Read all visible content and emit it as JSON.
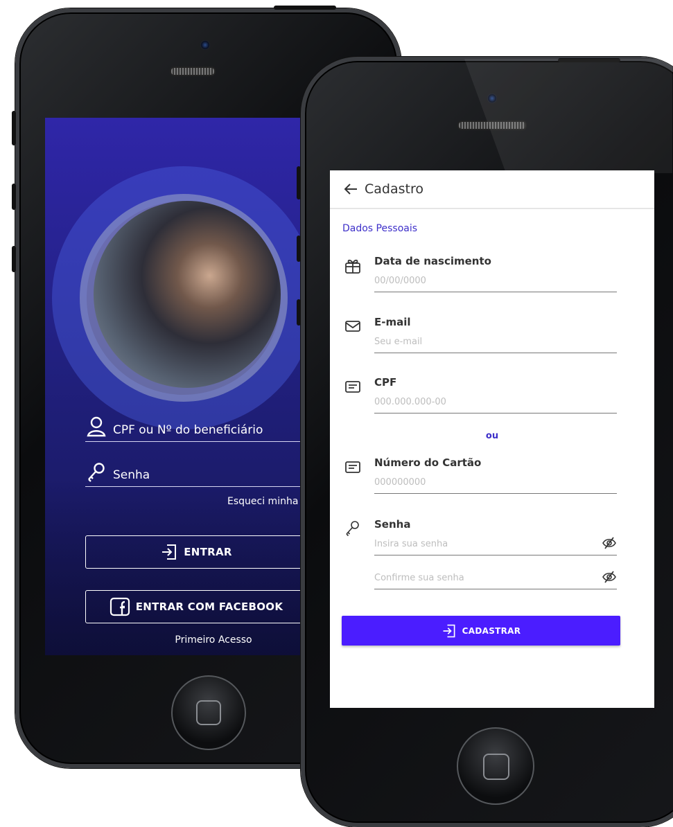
{
  "login": {
    "cpf_placeholder": "CPF ou Nº do beneficiário",
    "password_placeholder": "Senha",
    "forgot": "Esqueci minha senha",
    "enter_label": "ENTRAR",
    "facebook_label": "ENTRAR COM FACEBOOK",
    "first_access": "Primeiro Acesso"
  },
  "signup": {
    "title": "Cadastro",
    "section": "Dados Pessoais",
    "birth": {
      "label": "Data de nascimento",
      "placeholder": "00/00/0000"
    },
    "email": {
      "label": "E-mail",
      "placeholder": "Seu e-mail"
    },
    "cpf": {
      "label": "CPF",
      "placeholder": "000.000.000-00"
    },
    "or": "ou",
    "card": {
      "label": "Número do Cartão",
      "placeholder": "000000000"
    },
    "password": {
      "label": "Senha",
      "placeholder": "Insira sua senha",
      "confirm_placeholder": "Confirme sua senha"
    },
    "submit": "CADASTRAR"
  },
  "colors": {
    "brand": "#4b1dff",
    "accent_text": "#3d2fc9",
    "login_bg": "#21207f"
  }
}
